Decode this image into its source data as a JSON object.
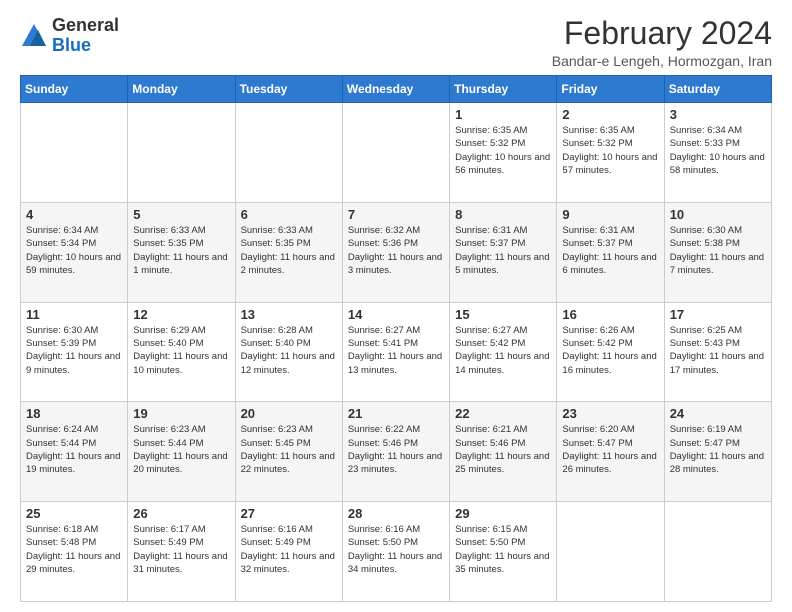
{
  "header": {
    "logo_general": "General",
    "logo_blue": "Blue",
    "month_title": "February 2024",
    "location": "Bandar-e Lengeh, Hormozgan, Iran"
  },
  "days_of_week": [
    "Sunday",
    "Monday",
    "Tuesday",
    "Wednesday",
    "Thursday",
    "Friday",
    "Saturday"
  ],
  "weeks": [
    [
      {
        "day": "",
        "info": ""
      },
      {
        "day": "",
        "info": ""
      },
      {
        "day": "",
        "info": ""
      },
      {
        "day": "",
        "info": ""
      },
      {
        "day": "1",
        "info": "Sunrise: 6:35 AM\nSunset: 5:32 PM\nDaylight: 10 hours and 56 minutes."
      },
      {
        "day": "2",
        "info": "Sunrise: 6:35 AM\nSunset: 5:32 PM\nDaylight: 10 hours and 57 minutes."
      },
      {
        "day": "3",
        "info": "Sunrise: 6:34 AM\nSunset: 5:33 PM\nDaylight: 10 hours and 58 minutes."
      }
    ],
    [
      {
        "day": "4",
        "info": "Sunrise: 6:34 AM\nSunset: 5:34 PM\nDaylight: 10 hours and 59 minutes."
      },
      {
        "day": "5",
        "info": "Sunrise: 6:33 AM\nSunset: 5:35 PM\nDaylight: 11 hours and 1 minute."
      },
      {
        "day": "6",
        "info": "Sunrise: 6:33 AM\nSunset: 5:35 PM\nDaylight: 11 hours and 2 minutes."
      },
      {
        "day": "7",
        "info": "Sunrise: 6:32 AM\nSunset: 5:36 PM\nDaylight: 11 hours and 3 minutes."
      },
      {
        "day": "8",
        "info": "Sunrise: 6:31 AM\nSunset: 5:37 PM\nDaylight: 11 hours and 5 minutes."
      },
      {
        "day": "9",
        "info": "Sunrise: 6:31 AM\nSunset: 5:37 PM\nDaylight: 11 hours and 6 minutes."
      },
      {
        "day": "10",
        "info": "Sunrise: 6:30 AM\nSunset: 5:38 PM\nDaylight: 11 hours and 7 minutes."
      }
    ],
    [
      {
        "day": "11",
        "info": "Sunrise: 6:30 AM\nSunset: 5:39 PM\nDaylight: 11 hours and 9 minutes."
      },
      {
        "day": "12",
        "info": "Sunrise: 6:29 AM\nSunset: 5:40 PM\nDaylight: 11 hours and 10 minutes."
      },
      {
        "day": "13",
        "info": "Sunrise: 6:28 AM\nSunset: 5:40 PM\nDaylight: 11 hours and 12 minutes."
      },
      {
        "day": "14",
        "info": "Sunrise: 6:27 AM\nSunset: 5:41 PM\nDaylight: 11 hours and 13 minutes."
      },
      {
        "day": "15",
        "info": "Sunrise: 6:27 AM\nSunset: 5:42 PM\nDaylight: 11 hours and 14 minutes."
      },
      {
        "day": "16",
        "info": "Sunrise: 6:26 AM\nSunset: 5:42 PM\nDaylight: 11 hours and 16 minutes."
      },
      {
        "day": "17",
        "info": "Sunrise: 6:25 AM\nSunset: 5:43 PM\nDaylight: 11 hours and 17 minutes."
      }
    ],
    [
      {
        "day": "18",
        "info": "Sunrise: 6:24 AM\nSunset: 5:44 PM\nDaylight: 11 hours and 19 minutes."
      },
      {
        "day": "19",
        "info": "Sunrise: 6:23 AM\nSunset: 5:44 PM\nDaylight: 11 hours and 20 minutes."
      },
      {
        "day": "20",
        "info": "Sunrise: 6:23 AM\nSunset: 5:45 PM\nDaylight: 11 hours and 22 minutes."
      },
      {
        "day": "21",
        "info": "Sunrise: 6:22 AM\nSunset: 5:46 PM\nDaylight: 11 hours and 23 minutes."
      },
      {
        "day": "22",
        "info": "Sunrise: 6:21 AM\nSunset: 5:46 PM\nDaylight: 11 hours and 25 minutes."
      },
      {
        "day": "23",
        "info": "Sunrise: 6:20 AM\nSunset: 5:47 PM\nDaylight: 11 hours and 26 minutes."
      },
      {
        "day": "24",
        "info": "Sunrise: 6:19 AM\nSunset: 5:47 PM\nDaylight: 11 hours and 28 minutes."
      }
    ],
    [
      {
        "day": "25",
        "info": "Sunrise: 6:18 AM\nSunset: 5:48 PM\nDaylight: 11 hours and 29 minutes."
      },
      {
        "day": "26",
        "info": "Sunrise: 6:17 AM\nSunset: 5:49 PM\nDaylight: 11 hours and 31 minutes."
      },
      {
        "day": "27",
        "info": "Sunrise: 6:16 AM\nSunset: 5:49 PM\nDaylight: 11 hours and 32 minutes."
      },
      {
        "day": "28",
        "info": "Sunrise: 6:16 AM\nSunset: 5:50 PM\nDaylight: 11 hours and 34 minutes."
      },
      {
        "day": "29",
        "info": "Sunrise: 6:15 AM\nSunset: 5:50 PM\nDaylight: 11 hours and 35 minutes."
      },
      {
        "day": "",
        "info": ""
      },
      {
        "day": "",
        "info": ""
      }
    ]
  ]
}
